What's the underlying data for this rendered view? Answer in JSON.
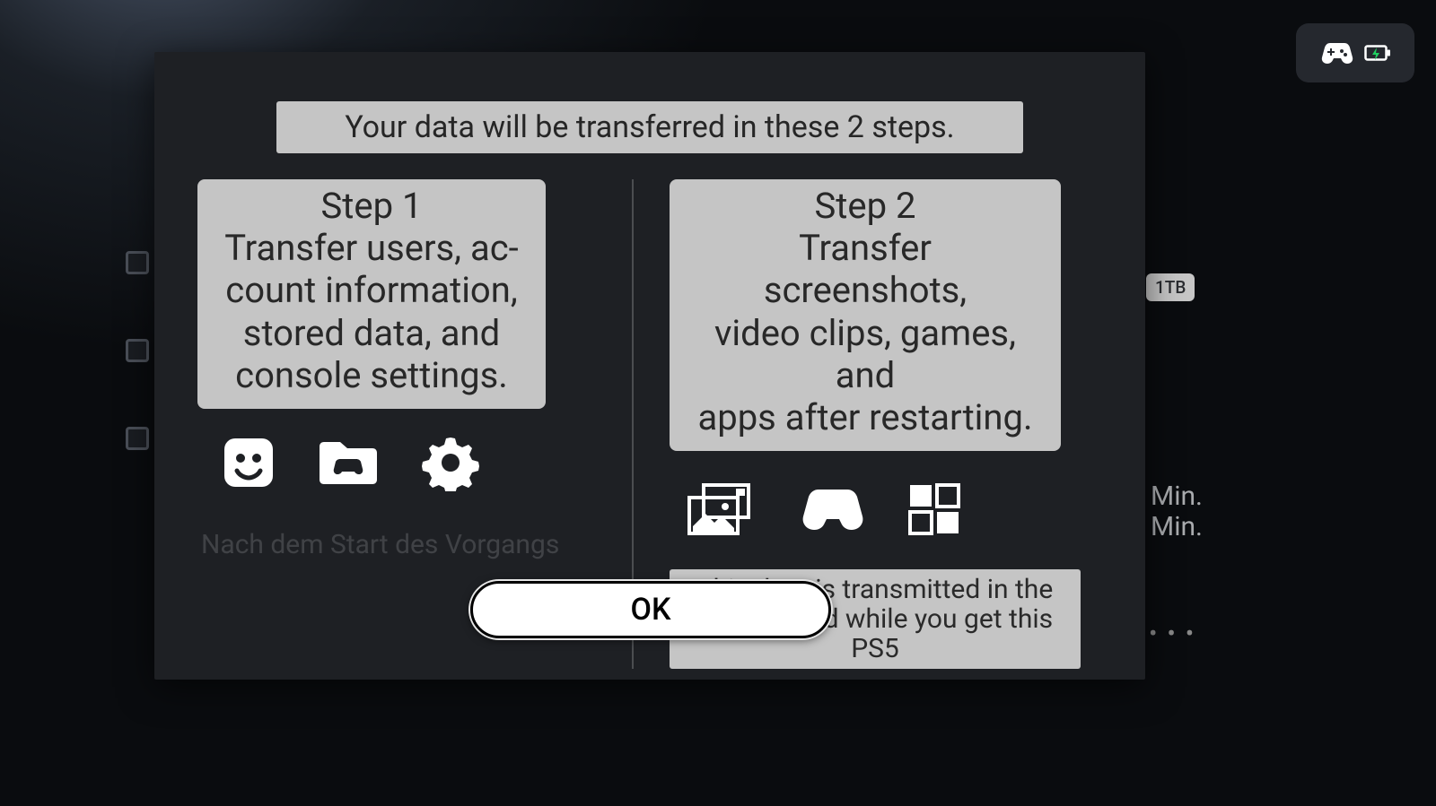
{
  "title": "Your data will be transferred in these 2 steps.",
  "steps": [
    {
      "heading": "Step 1",
      "body": "Transfer users, ac-\ncount information,\nstored data, and\nconsole settings.",
      "icons": [
        "user-smile-icon",
        "folder-game-icon",
        "gear-icon"
      ]
    },
    {
      "heading": "Step 2",
      "body": "Transfer screenshots,\nvideo clips, games, and\napps after restarting.",
      "icons": [
        "media-icon",
        "controller-icon",
        "apps-grid-icon"
      ],
      "note": "This data is transmitted in the\nbackground while you get this PS5"
    }
  ],
  "faded_text": "Nach dem Start des Vorgangs musst",
  "ok_label": "OK",
  "background": {
    "storage_badge": "1TB",
    "min_labels": [
      "Min.",
      "Min."
    ],
    "dots": "• • •"
  },
  "status": {
    "icons": [
      "controller-icon",
      "battery-charging-icon"
    ]
  },
  "colors": {
    "dialog_bg": "#1e2024",
    "box_bg": "#c5c5c5",
    "box_text": "#262626",
    "battery_charge": "#20d060"
  }
}
